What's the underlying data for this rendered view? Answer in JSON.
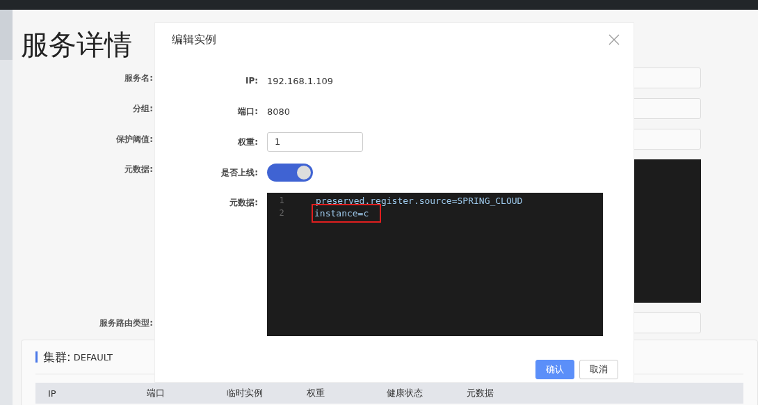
{
  "page": {
    "title": "服务详情",
    "form": [
      {
        "label": "服务名:",
        "kind": "input"
      },
      {
        "label": "分组:",
        "kind": "input"
      },
      {
        "label": "保护阈值:",
        "kind": "input"
      },
      {
        "label": "元数据:",
        "kind": "editor"
      },
      {
        "label": "服务路由类型:",
        "kind": "input"
      }
    ],
    "cluster": {
      "label": "集群:",
      "name": "DEFAULT",
      "columns": [
        "IP",
        "端口",
        "临时实例",
        "权重",
        "健康状态",
        "元数据"
      ]
    }
  },
  "dialog": {
    "title": "编辑实例",
    "fields": [
      {
        "label": "IP:",
        "kind": "text",
        "value": "192.168.1.109"
      },
      {
        "label": "端口:",
        "kind": "text",
        "value": "8080"
      },
      {
        "label": "权重:",
        "kind": "input",
        "value": "1"
      },
      {
        "label": "是否上线:",
        "kind": "switch",
        "on": true
      },
      {
        "label": "元数据:",
        "kind": "editor",
        "lines": [
          {
            "number": "1",
            "text": "preserved.register.source=SPRING_CLOUD",
            "highlighted": false
          },
          {
            "number": "2",
            "text": "instance=c",
            "highlighted": true
          }
        ]
      }
    ],
    "buttons": [
      {
        "label": "确认",
        "primary": true
      },
      {
        "label": "取消",
        "primary": false
      }
    ]
  }
}
